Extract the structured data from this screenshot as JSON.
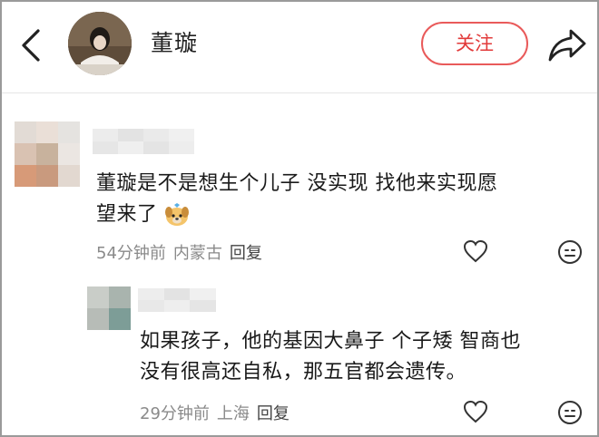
{
  "header": {
    "author_name": "董璇",
    "follow_label": "关注"
  },
  "comments": [
    {
      "line1": "董璇是不是想生个儿子 没实现 找他来实现愿",
      "line2": "望来了",
      "time": "54分钟前",
      "location": "内蒙古",
      "reply_label": "回复"
    },
    {
      "line1": "如果孩子，他的基因大鼻子 个子矮 智商也",
      "line2": "没有很高还自私，那五官都会遗传。",
      "time": "29分钟前",
      "location": "上海",
      "reply_label": "回复"
    }
  ],
  "colors": {
    "follow_accent": "#e23a3a",
    "meta_text": "#8a8a8a"
  },
  "icons": [
    "back-chevron-icon",
    "share-arrow-icon",
    "heart-outline-icon",
    "smiley-icon",
    "dog-emoji-icon"
  ]
}
